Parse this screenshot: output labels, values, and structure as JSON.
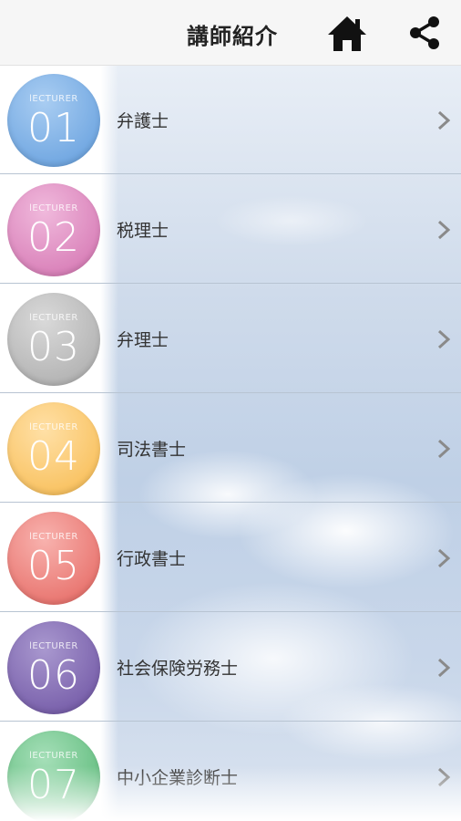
{
  "header": {
    "title": "講師紹介"
  },
  "badge_caption": "lECTURER",
  "items": [
    {
      "number": "01",
      "label": "弁護士",
      "color_top": "#a9cdf2",
      "color_bottom": "#5f9bdc"
    },
    {
      "number": "02",
      "label": "税理士",
      "color_top": "#f0b9dc",
      "color_bottom": "#d26fae"
    },
    {
      "number": "03",
      "label": "弁理士",
      "color_top": "#d9d9d9",
      "color_bottom": "#a8a8a8"
    },
    {
      "number": "04",
      "label": "司法書士",
      "color_top": "#ffe0a6",
      "color_bottom": "#f7b94c"
    },
    {
      "number": "05",
      "label": "行政書士",
      "color_top": "#f8b2ae",
      "color_bottom": "#e4625c"
    },
    {
      "number": "06",
      "label": "社会保険労務士",
      "color_top": "#a998cf",
      "color_bottom": "#6a4fa0"
    },
    {
      "number": "07",
      "label": "中小企業診断士",
      "color_top": "#a5dfb8",
      "color_bottom": "#4fb36e"
    }
  ]
}
